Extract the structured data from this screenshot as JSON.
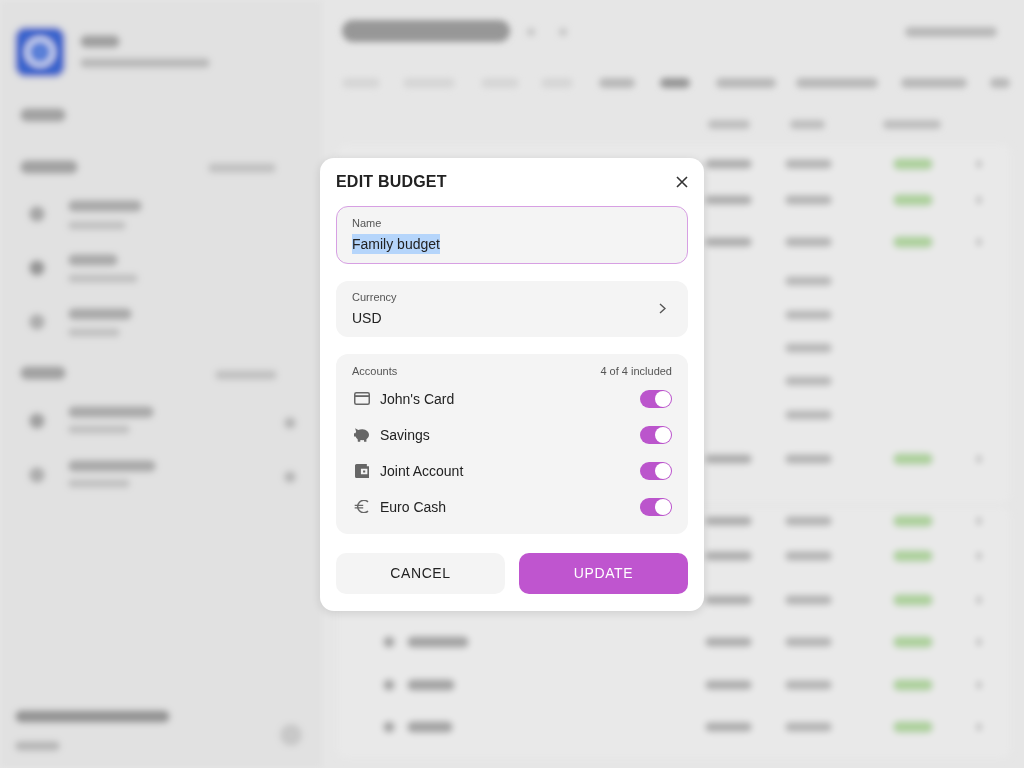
{
  "backdrop_blurred": true,
  "dialog": {
    "title": "EDIT BUDGET",
    "name_field": {
      "label": "Name",
      "value": "Family budget",
      "focused": true,
      "text_selected": true
    },
    "currency_field": {
      "label": "Currency",
      "value": "USD"
    },
    "accounts": {
      "label": "Accounts",
      "summary": "4 of 4 included",
      "items": [
        {
          "name": "John's Card",
          "kind": "card",
          "on": true
        },
        {
          "name": "Savings",
          "kind": "piggy-bank",
          "on": true
        },
        {
          "name": "Joint Account",
          "kind": "wallet",
          "on": true
        },
        {
          "name": "Euro Cash",
          "kind": "euro",
          "on": true
        }
      ]
    },
    "buttons": [
      {
        "label": "CANCEL",
        "kind": "secondary"
      },
      {
        "label": "UPDATE",
        "kind": "primary"
      }
    ]
  }
}
